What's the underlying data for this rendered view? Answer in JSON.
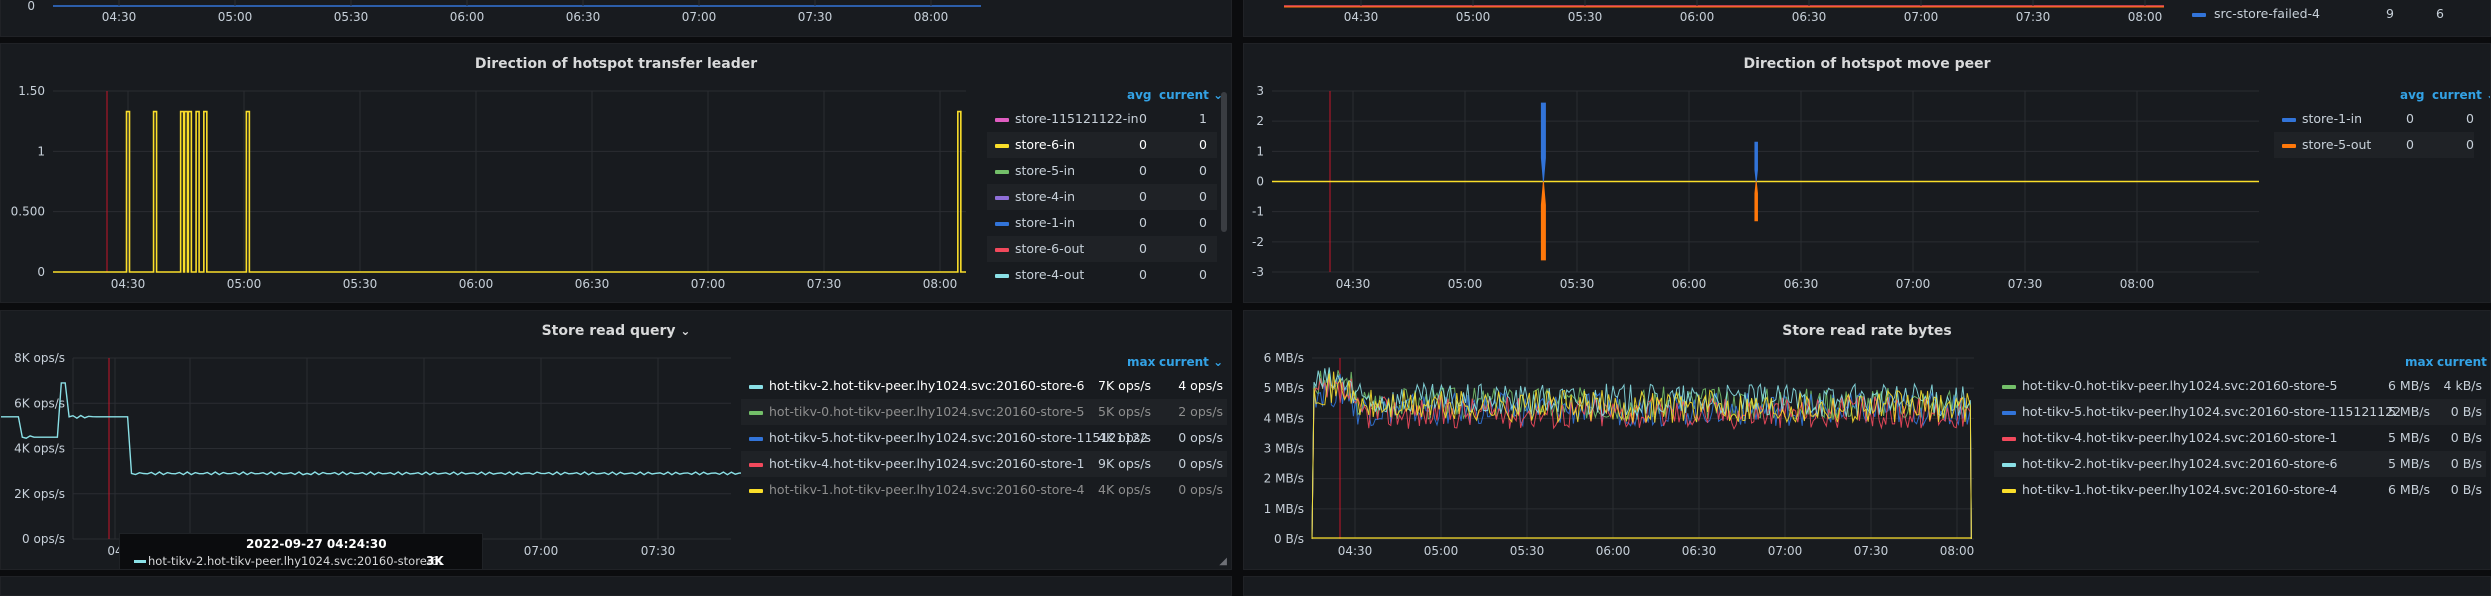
{
  "colors": {
    "yellow": "#fade2a",
    "blue": "#3274d9",
    "orange": "#ff780a",
    "green": "#73bf69",
    "pink": "#e05dc1",
    "purple": "#8f6fd8",
    "red": "#f2495c",
    "cyan": "#8ae0e6",
    "teal": "#5ac8d8",
    "grid": "#2a2d32",
    "accent": "#33a2e5"
  },
  "top_left": {
    "y_tick": "0",
    "x_ticks": [
      "04:30",
      "05:00",
      "05:30",
      "06:00",
      "06:30",
      "07:00",
      "07:30",
      "08:00"
    ]
  },
  "top_right": {
    "x_ticks": [
      "04:30",
      "05:00",
      "05:30",
      "06:00",
      "06:30",
      "07:00",
      "07:30",
      "08:00"
    ],
    "legend_row": {
      "name": "src-store-failed-4",
      "v1": "9",
      "v2": "6"
    }
  },
  "leader_panel": {
    "title": "Direction of hotspot transfer leader",
    "legend_avg": "avg",
    "legend_current": "current",
    "sort_icon": "chevron-down-icon",
    "legend": [
      {
        "name": "store-115121122-in",
        "avg": "0",
        "current": "1",
        "color": "#e05dc1"
      },
      {
        "name": "store-6-in",
        "avg": "0",
        "current": "0",
        "color": "#fade2a"
      },
      {
        "name": "store-5-in",
        "avg": "0",
        "current": "0",
        "color": "#73bf69"
      },
      {
        "name": "store-4-in",
        "avg": "0",
        "current": "0",
        "color": "#8f6fd8"
      },
      {
        "name": "store-1-in",
        "avg": "0",
        "current": "0",
        "color": "#3274d9"
      },
      {
        "name": "store-6-out",
        "avg": "0",
        "current": "0",
        "color": "#f2495c"
      },
      {
        "name": "store-4-out",
        "avg": "0",
        "current": "0",
        "color": "#8ae0e6"
      }
    ]
  },
  "move_panel": {
    "title": "Direction of hotspot move peer",
    "legend_avg": "avg",
    "legend_current": "current",
    "legend": [
      {
        "name": "store-1-in",
        "avg": "0",
        "current": "0",
        "color": "#3274d9"
      },
      {
        "name": "store-5-out",
        "avg": "0",
        "current": "0",
        "color": "#ff780a"
      }
    ]
  },
  "query_panel": {
    "title": "Store read query",
    "legend_max": "max",
    "legend_current": "current",
    "legend": [
      {
        "name": "hot-tikv-2.hot-tikv-peer.lhy1024.svc:20160-store-6",
        "max": "7K ops/s",
        "current": "4 ops/s",
        "color": "#8ae0e6"
      },
      {
        "name": "hot-tikv-0.hot-tikv-peer.lhy1024.svc:20160-store-5",
        "max": "5K ops/s",
        "current": "2 ops/s",
        "color": "#73bf69"
      },
      {
        "name": "hot-tikv-5.hot-tikv-peer.lhy1024.svc:20160-store-115121122",
        "max": "4K ops/s",
        "current": "0 ops/s",
        "color": "#3274d9"
      },
      {
        "name": "hot-tikv-4.hot-tikv-peer.lhy1024.svc:20160-store-1",
        "max": "9K ops/s",
        "current": "0 ops/s",
        "color": "#f2495c"
      },
      {
        "name": "hot-tikv-1.hot-tikv-peer.lhy1024.svc:20160-store-4",
        "max": "4K ops/s",
        "current": "0 ops/s",
        "color": "#fade2a"
      }
    ],
    "tooltip": {
      "time": "2022-09-27 04:24:30",
      "series": "hot-tikv-2.hot-tikv-peer.lhy1024.svc:20160-store-6:",
      "value": "3K ops/s"
    },
    "x_tick_partial": "04"
  },
  "bytes_panel": {
    "title": "Store read rate bytes",
    "legend_max": "max",
    "legend_current": "current",
    "legend": [
      {
        "name": "hot-tikv-0.hot-tikv-peer.lhy1024.svc:20160-store-5",
        "max": "6 MB/s",
        "current": "4 kB/s",
        "color": "#73bf69"
      },
      {
        "name": "hot-tikv-5.hot-tikv-peer.lhy1024.svc:20160-store-115121122",
        "max": "5 MB/s",
        "current": "0 B/s",
        "color": "#3274d9"
      },
      {
        "name": "hot-tikv-4.hot-tikv-peer.lhy1024.svc:20160-store-1",
        "max": "5 MB/s",
        "current": "0 B/s",
        "color": "#f2495c"
      },
      {
        "name": "hot-tikv-2.hot-tikv-peer.lhy1024.svc:20160-store-6",
        "max": "5 MB/s",
        "current": "0 B/s",
        "color": "#8ae0e6"
      },
      {
        "name": "hot-tikv-1.hot-tikv-peer.lhy1024.svc:20160-store-4",
        "max": "6 MB/s",
        "current": "0 B/s",
        "color": "#fade2a"
      }
    ]
  },
  "chart_data": [
    {
      "type": "line",
      "title": "Direction of hotspot transfer leader",
      "x_ticks": [
        "04:30",
        "05:00",
        "05:30",
        "06:00",
        "06:30",
        "07:00",
        "07:30",
        "08:00"
      ],
      "y_ticks": [
        "0",
        "0.500",
        "1",
        "1.50"
      ],
      "ylim": [
        0,
        1.5
      ],
      "series": [
        {
          "name": "store-6-in",
          "color": "#fade2a",
          "x": [
            "04:30",
            "04:37",
            "04:44",
            "04:45",
            "04:46",
            "04:48",
            "04:50",
            "05:01",
            "08:05"
          ],
          "values": [
            1.33,
            1.33,
            1.33,
            1.33,
            1.33,
            1.33,
            1.33,
            1.33,
            1.33
          ]
        }
      ]
    },
    {
      "type": "line",
      "title": "Direction of hotspot move peer",
      "x_ticks": [
        "04:30",
        "05:00",
        "05:30",
        "06:00",
        "06:30",
        "07:00",
        "07:30",
        "08:00"
      ],
      "y_ticks": [
        "-3",
        "-2",
        "-1",
        "0",
        "1",
        "2",
        "3"
      ],
      "ylim": [
        -3,
        3
      ],
      "series": [
        {
          "name": "store-1-in",
          "color": "#3274d9",
          "x": [
            "05:21",
            "06:18"
          ],
          "values": [
            2.6,
            1.3
          ]
        },
        {
          "name": "store-5-out",
          "color": "#ff780a",
          "x": [
            "05:21",
            "06:18"
          ],
          "values": [
            -2.6,
            -1.3
          ]
        }
      ]
    },
    {
      "type": "line",
      "title": "Store read query",
      "x_ticks": [
        "04",
        "07:00",
        "07:30",
        "08:00"
      ],
      "y_ticks": [
        "0 ops/s",
        "2K ops/s",
        "4K ops/s",
        "6K ops/s",
        "8K ops/s"
      ],
      "ylim": [
        0,
        8000
      ],
      "series": [
        {
          "name": "hot-tikv-2.hot-tikv-peer.lhy1024.svc:20160-store-6",
          "color": "#8ae0e6",
          "x": [
            "04:15",
            "04:16",
            "04:21",
            "04:24",
            "04:27",
            "04:30",
            "04:36",
            "04:40",
            "04:47",
            "04:50",
            "04:57",
            "04:59",
            "05:06",
            "05:15",
            "06:00",
            "07:00",
            "08:00",
            "08:05"
          ],
          "values": [
            0,
            5800,
            3000,
            3000,
            7000,
            5800,
            5600,
            5400,
            4500,
            4500,
            6900,
            5400,
            5400,
            2900,
            2900,
            2900,
            2900,
            0
          ]
        }
      ]
    },
    {
      "type": "line",
      "title": "Store read rate bytes",
      "x_ticks": [
        "04:30",
        "05:00",
        "05:30",
        "06:00",
        "06:30",
        "07:00",
        "07:30",
        "08:00"
      ],
      "y_ticks": [
        "0 B/s",
        "1 MB/s",
        "2 MB/s",
        "3 MB/s",
        "4 MB/s",
        "5 MB/s",
        "6 MB/s"
      ],
      "ylim": [
        0,
        6
      ],
      "series": [
        {
          "name": "hot-tikv-0.hot-tikv-peer.lhy1024.svc:20160-store-5",
          "color": "#73bf69",
          "level": 4.5
        },
        {
          "name": "hot-tikv-5.hot-tikv-peer.lhy1024.svc:20160-store-115121122",
          "color": "#3274d9",
          "level": 4.3
        },
        {
          "name": "hot-tikv-4.hot-tikv-peer.lhy1024.svc:20160-store-1",
          "color": "#f2495c",
          "level": 4.2
        },
        {
          "name": "hot-tikv-2.hot-tikv-peer.lhy1024.svc:20160-store-6",
          "color": "#8ae0e6",
          "level": 4.6
        },
        {
          "name": "hot-tikv-1.hot-tikv-peer.lhy1024.svc:20160-store-4",
          "color": "#fade2a",
          "level": 4.4
        }
      ]
    }
  ]
}
